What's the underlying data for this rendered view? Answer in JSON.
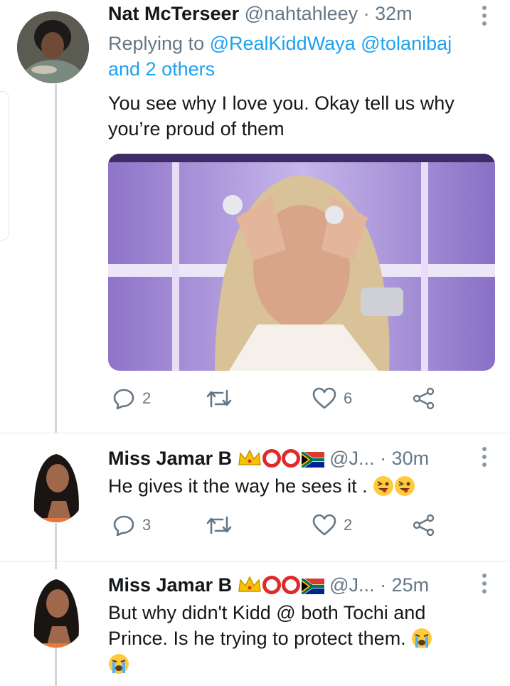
{
  "tweets": [
    {
      "name": "Nat McTerseer",
      "handle": "@nahtahleey",
      "time": "· 32m",
      "replying_prefix": "Replying to",
      "mention_1": "@RealKiddWaya",
      "mention_2": "@tolanibaj",
      "mention_others": "and 2 others",
      "text_line1": "You see why I love you. Okay tell us why",
      "text_line2": "you’re proud of them",
      "replies": "2",
      "retweets": "",
      "likes": "6"
    },
    {
      "name": "Miss Jamar B",
      "handle": "@J...",
      "time": "· 30m",
      "text": "He gives it the way he sees it .",
      "emojis": [
        "squinting-tongue-emoji",
        "squinting-tongue-emoji"
      ],
      "replies": "3",
      "retweets": "",
      "likes": "2"
    },
    {
      "name": "Miss Jamar B",
      "handle": "@J...",
      "time": "· 25m",
      "text_line1": "But why didn't Kidd @ both Tochi and",
      "text_line2": "Prince.  Is he trying to protect them.",
      "emojis": [
        "loudly-crying-emoji",
        "loudly-crying-emoji"
      ]
    }
  ],
  "name_decorations": [
    "crown-emoji",
    "red-circle-emoji",
    "red-circle-emoji",
    "south-africa-flag-emoji"
  ],
  "colors": {
    "link": "#1da1f2",
    "meta": "#657786",
    "text": "#14171a",
    "thread_line": "#cfd9de"
  }
}
